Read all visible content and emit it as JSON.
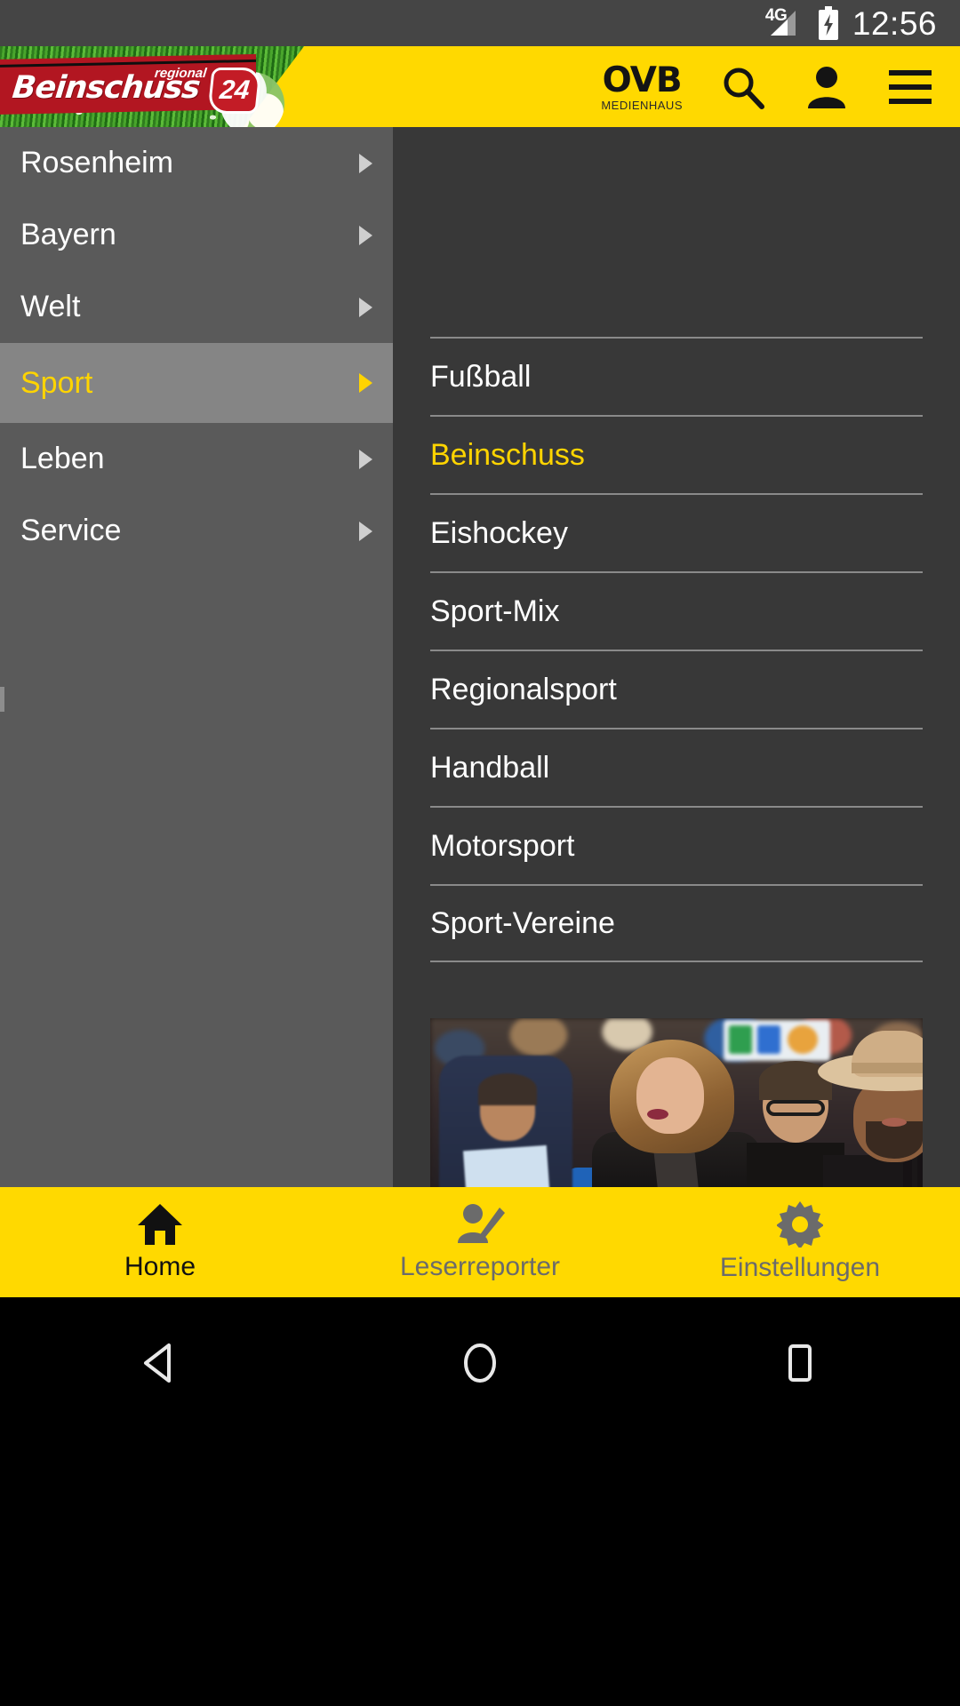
{
  "status_bar": {
    "network_label": "4G",
    "time": "12:56",
    "battery_icon": "battery-charging-icon",
    "signal_icon": "signal-bars-icon"
  },
  "header": {
    "logo": {
      "brand": "Beinschuss",
      "tagline": "regional",
      "badge": "24",
      "name": "beinschuss24-logo"
    },
    "publisher": {
      "name": "OVB",
      "subtitle": "MEDIENHAUS"
    },
    "icons": [
      {
        "name": "search-icon",
        "label": "Suche"
      },
      {
        "name": "user-icon",
        "label": "Benutzerkonto"
      },
      {
        "name": "hamburger-menu-icon",
        "label": "Menü"
      }
    ]
  },
  "drawer": {
    "items": [
      {
        "label": "Rosenheim",
        "selected": false
      },
      {
        "label": "Bayern",
        "selected": false
      },
      {
        "label": "Welt",
        "selected": false
      },
      {
        "label": "Sport",
        "selected": true
      },
      {
        "label": "Leben",
        "selected": false
      },
      {
        "label": "Service",
        "selected": false
      }
    ]
  },
  "submenu": {
    "items": [
      {
        "label": "Fußball",
        "selected": false
      },
      {
        "label": "Beinschuss",
        "selected": true
      },
      {
        "label": "Eishockey",
        "selected": false
      },
      {
        "label": "Sport-Mix",
        "selected": false
      },
      {
        "label": "Regionalsport",
        "selected": false
      },
      {
        "label": "Handball",
        "selected": false
      },
      {
        "label": "Motorsport",
        "selected": false
      },
      {
        "label": "Sport-Vereine",
        "selected": false
      }
    ],
    "teaser_image": "crowd-at-sports-event-photo"
  },
  "tab_bar": {
    "tabs": [
      {
        "label": "Home",
        "icon": "home-icon",
        "active": true
      },
      {
        "label": "Leserreporter",
        "icon": "reporter-person-pencil-icon",
        "active": false
      },
      {
        "label": "Einstellungen",
        "icon": "gear-icon",
        "active": false
      }
    ]
  },
  "nav_bar": {
    "buttons": [
      {
        "name": "back-button",
        "icon": "triangle-back-icon"
      },
      {
        "name": "home-button",
        "icon": "circle-home-icon"
      },
      {
        "name": "recents-button",
        "icon": "square-recents-icon"
      }
    ]
  },
  "colors": {
    "brand_yellow": "#FFD900",
    "accent_yellow": "#FFD400",
    "drawer_bg": "#5a5a5a",
    "drawer_active_bg": "#858585",
    "submenu_bg": "#383838",
    "logo_red": "#B21621"
  }
}
